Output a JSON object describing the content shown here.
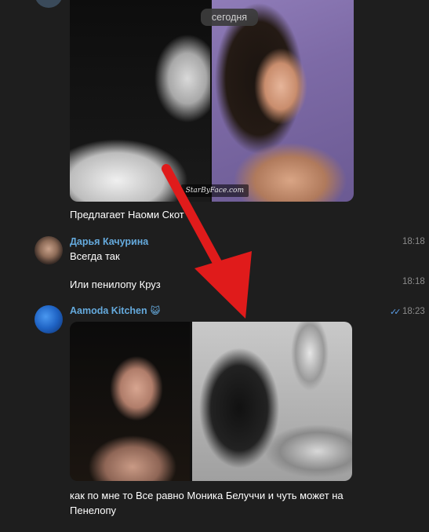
{
  "date_separator": "сегодня",
  "watermark": "StarByFace.com",
  "messages": [
    {
      "text": "Предлагает Наоми Скот"
    },
    {
      "sender": "Дарья Качурина",
      "text": "Всегда так",
      "time": "18:18"
    },
    {
      "text": "Или пенилопу Круз",
      "time": "18:18"
    },
    {
      "sender": "Aamoda Kitchen",
      "sender_emoji": "😺",
      "time": "18:23",
      "read_receipt": "✓✓",
      "text_line1": "как по мне то Все равно Моника Белуччи и чуть может на",
      "text_line2": "Пенелопу"
    }
  ],
  "colors": {
    "background": "#1e1e1e",
    "sender_name": "#65aadd",
    "timestamp": "#8a8a8a",
    "read_check": "#5c9ee6",
    "arrow": "#e01b1b"
  }
}
